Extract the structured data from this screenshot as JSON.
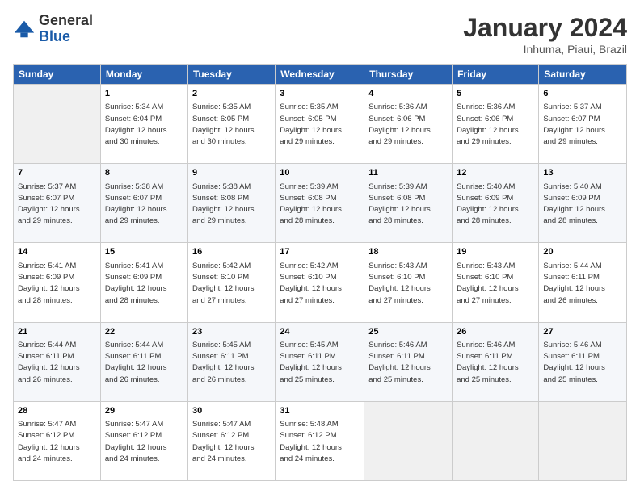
{
  "logo": {
    "general": "General",
    "blue": "Blue"
  },
  "title": "January 2024",
  "subtitle": "Inhuma, Piaui, Brazil",
  "days_header": [
    "Sunday",
    "Monday",
    "Tuesday",
    "Wednesday",
    "Thursday",
    "Friday",
    "Saturday"
  ],
  "weeks": [
    [
      {
        "day": "",
        "info": ""
      },
      {
        "day": "1",
        "info": "Sunrise: 5:34 AM\nSunset: 6:04 PM\nDaylight: 12 hours\nand 30 minutes."
      },
      {
        "day": "2",
        "info": "Sunrise: 5:35 AM\nSunset: 6:05 PM\nDaylight: 12 hours\nand 30 minutes."
      },
      {
        "day": "3",
        "info": "Sunrise: 5:35 AM\nSunset: 6:05 PM\nDaylight: 12 hours\nand 29 minutes."
      },
      {
        "day": "4",
        "info": "Sunrise: 5:36 AM\nSunset: 6:06 PM\nDaylight: 12 hours\nand 29 minutes."
      },
      {
        "day": "5",
        "info": "Sunrise: 5:36 AM\nSunset: 6:06 PM\nDaylight: 12 hours\nand 29 minutes."
      },
      {
        "day": "6",
        "info": "Sunrise: 5:37 AM\nSunset: 6:07 PM\nDaylight: 12 hours\nand 29 minutes."
      }
    ],
    [
      {
        "day": "7",
        "info": "Sunrise: 5:37 AM\nSunset: 6:07 PM\nDaylight: 12 hours\nand 29 minutes."
      },
      {
        "day": "8",
        "info": "Sunrise: 5:38 AM\nSunset: 6:07 PM\nDaylight: 12 hours\nand 29 minutes."
      },
      {
        "day": "9",
        "info": "Sunrise: 5:38 AM\nSunset: 6:08 PM\nDaylight: 12 hours\nand 29 minutes."
      },
      {
        "day": "10",
        "info": "Sunrise: 5:39 AM\nSunset: 6:08 PM\nDaylight: 12 hours\nand 28 minutes."
      },
      {
        "day": "11",
        "info": "Sunrise: 5:39 AM\nSunset: 6:08 PM\nDaylight: 12 hours\nand 28 minutes."
      },
      {
        "day": "12",
        "info": "Sunrise: 5:40 AM\nSunset: 6:09 PM\nDaylight: 12 hours\nand 28 minutes."
      },
      {
        "day": "13",
        "info": "Sunrise: 5:40 AM\nSunset: 6:09 PM\nDaylight: 12 hours\nand 28 minutes."
      }
    ],
    [
      {
        "day": "14",
        "info": "Sunrise: 5:41 AM\nSunset: 6:09 PM\nDaylight: 12 hours\nand 28 minutes."
      },
      {
        "day": "15",
        "info": "Sunrise: 5:41 AM\nSunset: 6:09 PM\nDaylight: 12 hours\nand 28 minutes."
      },
      {
        "day": "16",
        "info": "Sunrise: 5:42 AM\nSunset: 6:10 PM\nDaylight: 12 hours\nand 27 minutes."
      },
      {
        "day": "17",
        "info": "Sunrise: 5:42 AM\nSunset: 6:10 PM\nDaylight: 12 hours\nand 27 minutes."
      },
      {
        "day": "18",
        "info": "Sunrise: 5:43 AM\nSunset: 6:10 PM\nDaylight: 12 hours\nand 27 minutes."
      },
      {
        "day": "19",
        "info": "Sunrise: 5:43 AM\nSunset: 6:10 PM\nDaylight: 12 hours\nand 27 minutes."
      },
      {
        "day": "20",
        "info": "Sunrise: 5:44 AM\nSunset: 6:11 PM\nDaylight: 12 hours\nand 26 minutes."
      }
    ],
    [
      {
        "day": "21",
        "info": "Sunrise: 5:44 AM\nSunset: 6:11 PM\nDaylight: 12 hours\nand 26 minutes."
      },
      {
        "day": "22",
        "info": "Sunrise: 5:44 AM\nSunset: 6:11 PM\nDaylight: 12 hours\nand 26 minutes."
      },
      {
        "day": "23",
        "info": "Sunrise: 5:45 AM\nSunset: 6:11 PM\nDaylight: 12 hours\nand 26 minutes."
      },
      {
        "day": "24",
        "info": "Sunrise: 5:45 AM\nSunset: 6:11 PM\nDaylight: 12 hours\nand 25 minutes."
      },
      {
        "day": "25",
        "info": "Sunrise: 5:46 AM\nSunset: 6:11 PM\nDaylight: 12 hours\nand 25 minutes."
      },
      {
        "day": "26",
        "info": "Sunrise: 5:46 AM\nSunset: 6:11 PM\nDaylight: 12 hours\nand 25 minutes."
      },
      {
        "day": "27",
        "info": "Sunrise: 5:46 AM\nSunset: 6:11 PM\nDaylight: 12 hours\nand 25 minutes."
      }
    ],
    [
      {
        "day": "28",
        "info": "Sunrise: 5:47 AM\nSunset: 6:12 PM\nDaylight: 12 hours\nand 24 minutes."
      },
      {
        "day": "29",
        "info": "Sunrise: 5:47 AM\nSunset: 6:12 PM\nDaylight: 12 hours\nand 24 minutes."
      },
      {
        "day": "30",
        "info": "Sunrise: 5:47 AM\nSunset: 6:12 PM\nDaylight: 12 hours\nand 24 minutes."
      },
      {
        "day": "31",
        "info": "Sunrise: 5:48 AM\nSunset: 6:12 PM\nDaylight: 12 hours\nand 24 minutes."
      },
      {
        "day": "",
        "info": ""
      },
      {
        "day": "",
        "info": ""
      },
      {
        "day": "",
        "info": ""
      }
    ]
  ]
}
